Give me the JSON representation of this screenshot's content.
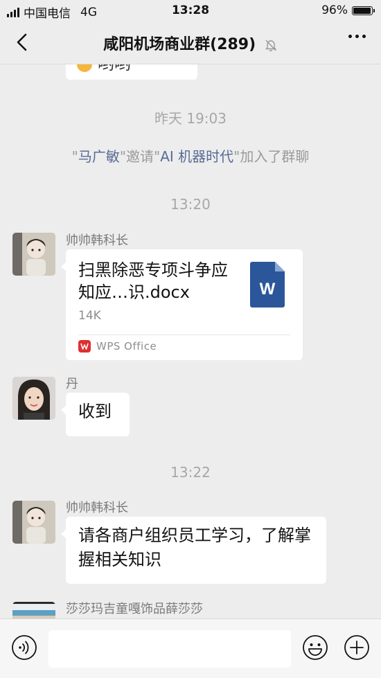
{
  "status_bar": {
    "carrier": "中国电信",
    "network": "4G",
    "time": "13:28",
    "battery": "96%",
    "battery_level": 0.96
  },
  "header": {
    "title": "咸阳机场商业群(289)",
    "back_icon": "chevron-left-icon",
    "mute_icon": "bell-muted-icon",
    "more_icon": "more-dots-icon"
  },
  "chat": {
    "partial_bubble_text": "哟哟",
    "timestamp_1": "昨天 19:03",
    "system_message": {
      "quote_open": "\"",
      "inviter": "马广敏",
      "mid": "\"邀请\"",
      "invitee": "AI 机器时代",
      "tail": "\"加入了群聊"
    },
    "timestamp_2": "13:20",
    "msg1": {
      "sender": "帅帅韩科长",
      "file_name": "扫黑除恶专项斗争应知应…识.docx",
      "file_size": "14K",
      "file_icon": "word-doc-icon",
      "file_icon_letter": "W",
      "source_app": "WPS Office",
      "source_icon": "wps-icon"
    },
    "msg2": {
      "sender": "丹",
      "text": "收到"
    },
    "timestamp_3": "13:22",
    "msg3": {
      "sender": "帅帅韩科长",
      "text": "请各商户组织员工学习，了解掌握相关知识"
    },
    "msg4": {
      "sender": "莎莎玛吉童嘎饰品薛莎莎"
    }
  },
  "input_bar": {
    "voice_icon": "voice-icon",
    "emoji_icon": "emoji-icon",
    "plus_icon": "plus-icon"
  },
  "colors": {
    "background": "#ededed",
    "link": "#576b95",
    "timestamp": "#a7a7a7",
    "word_blue": "#2b579a",
    "wps_red": "#e03030"
  }
}
